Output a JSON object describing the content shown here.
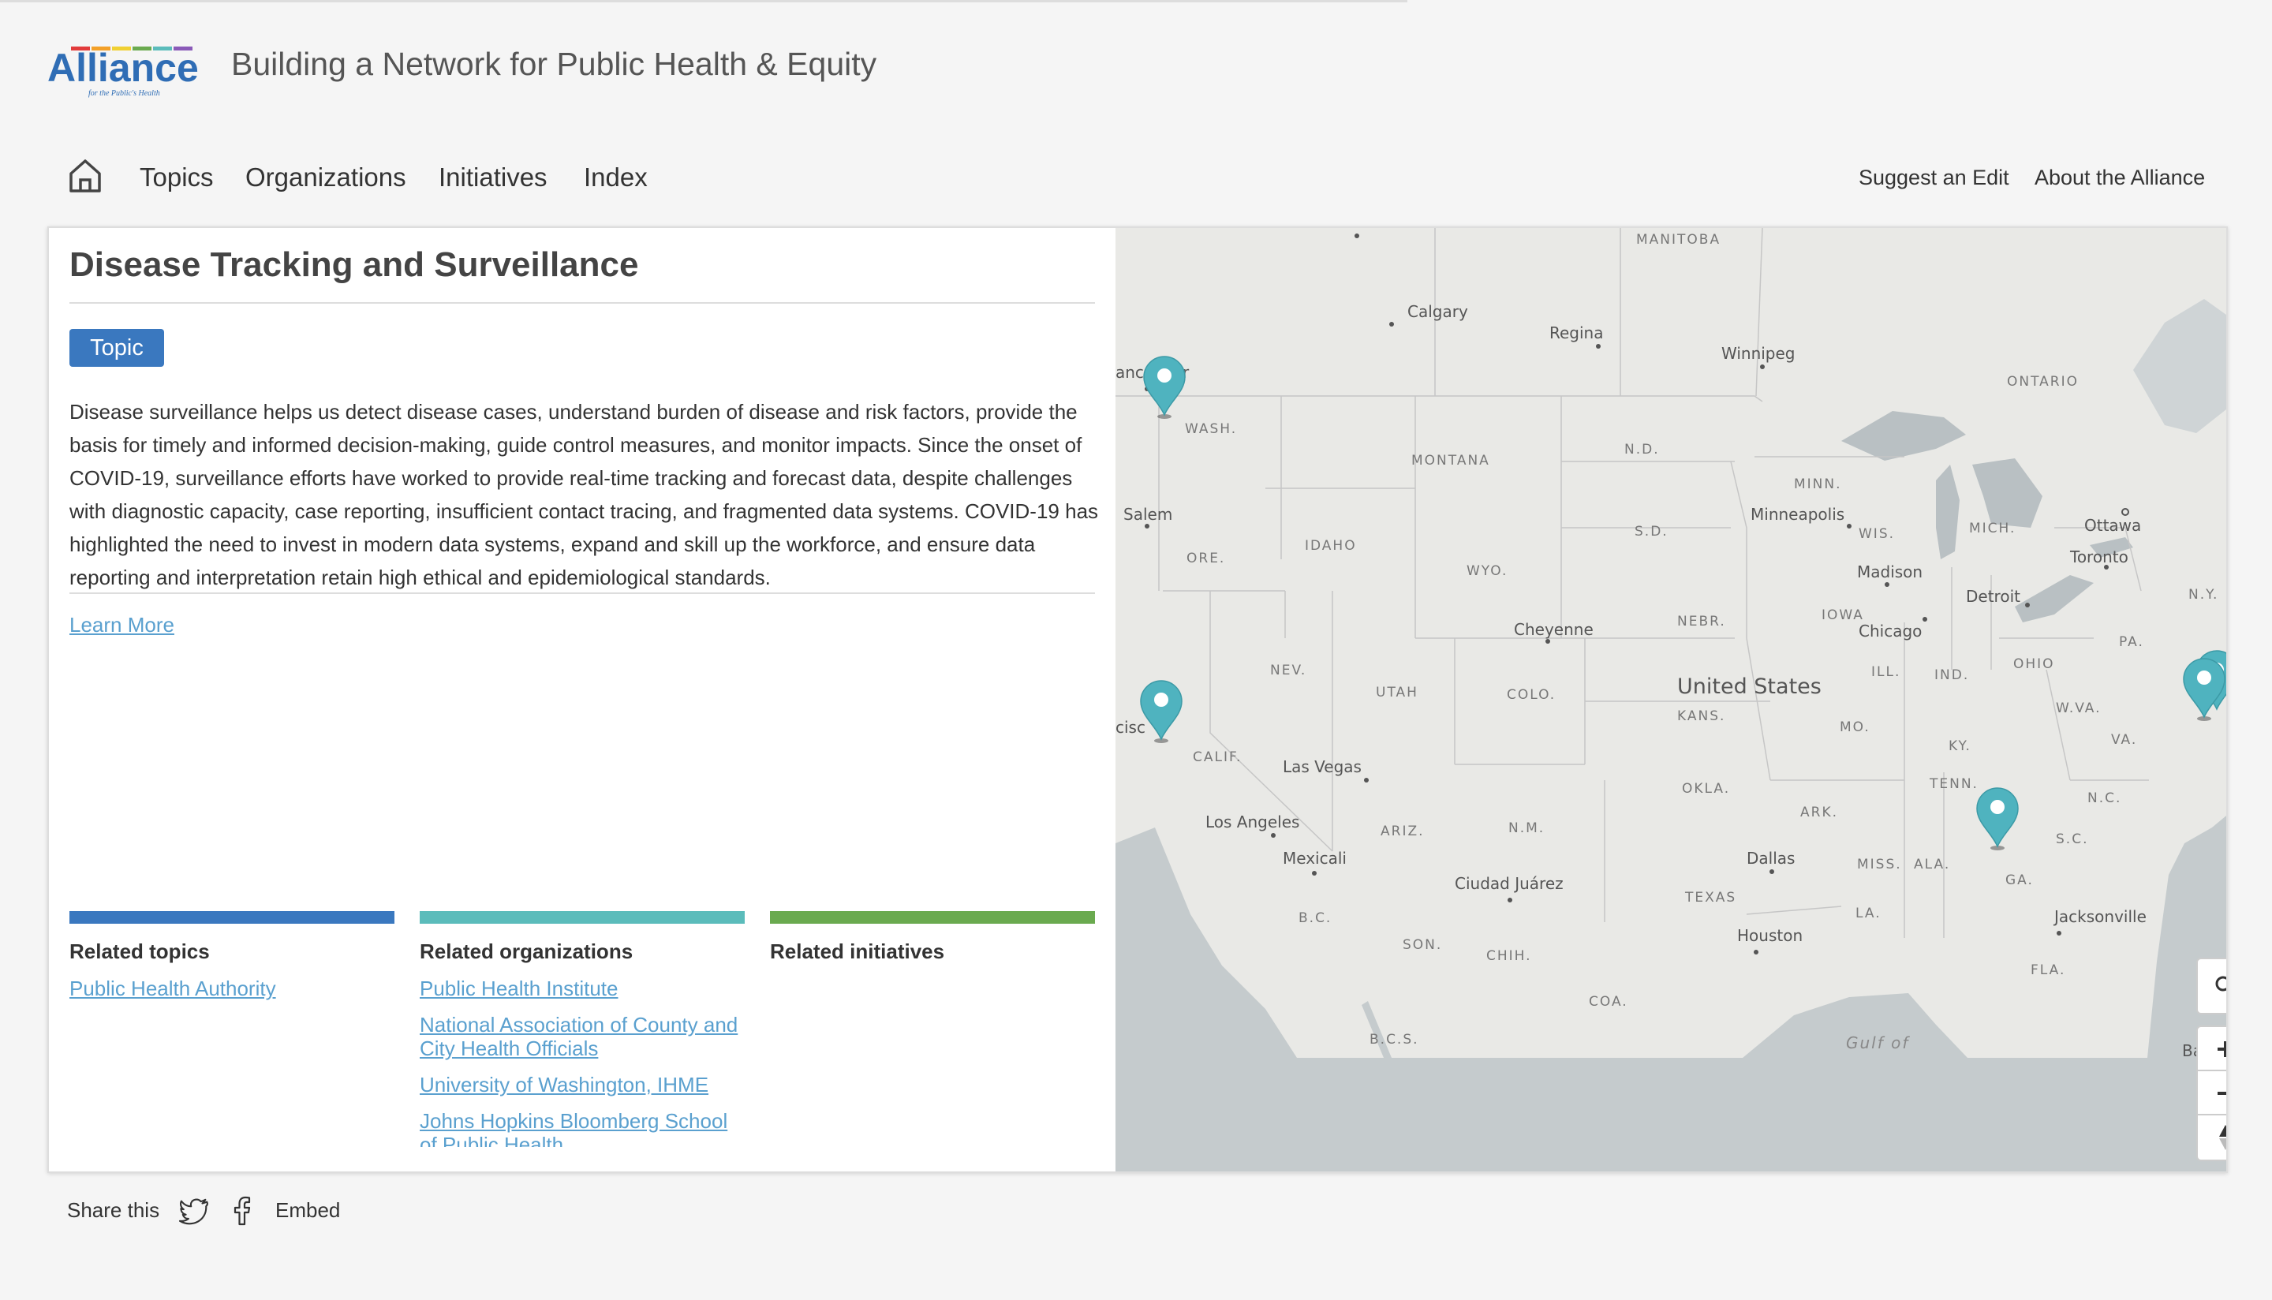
{
  "header": {
    "logo_text": "Alliance",
    "logo_tagline": "for the Public's Health",
    "site_title": "Building a Network for Public Health & Equity"
  },
  "nav": {
    "items": [
      {
        "label": "Topics"
      },
      {
        "label": "Organizations"
      },
      {
        "label": "Initiatives"
      },
      {
        "label": "Index"
      }
    ],
    "right": [
      {
        "label": "Suggest an Edit"
      },
      {
        "label": "About the Alliance"
      }
    ]
  },
  "article": {
    "title": "Disease Tracking and Surveillance",
    "badge": "Topic",
    "description": "Disease surveillance helps us detect disease cases, understand burden of disease and risk factors, provide the basis for timely and informed decision-making, guide control measures, and monitor impacts. Since the onset of COVID-19, surveillance efforts have worked to provide real-time tracking and forecast data, despite challenges with diagnostic capacity, case reporting, insufficient contact tracing, and fragmented data systems. COVID-19 has highlighted the need to invest in modern data systems, expand and skill up the workforce, and ensure data reporting and interpretation retain high ethical and epidemiological standards.",
    "learn_more": "Learn More"
  },
  "related": {
    "topics": {
      "heading": "Related topics",
      "color": "#3a78bf",
      "links": [
        "Public Health Authority"
      ]
    },
    "organizations": {
      "heading": "Related organizations",
      "color": "#5bbcbb",
      "links": [
        "Public Health Institute",
        "National Association of County and City Health Officials",
        "University of Washington, IHME",
        "Johns Hopkins Bloomberg School of Public Health"
      ]
    },
    "initiatives": {
      "heading": "Related initiatives",
      "color": "#6aaa4f",
      "links": []
    }
  },
  "map": {
    "marker_color": "#4fb3bf",
    "labels": {
      "manitoba": "MANITOBA",
      "ontario": "ONTARIO",
      "calgary": "Calgary",
      "regina": "Regina",
      "winnipeg": "Winnipeg",
      "vancouver": "ancouver",
      "wash": "WASH.",
      "montana": "MONTANA",
      "nd": "N.D.",
      "minn": "MINN.",
      "minneapolis": "Minneapolis",
      "salem": "Salem",
      "ore": "ORE.",
      "idaho": "IDAHO",
      "wyo": "WYO.",
      "sd": "S.D.",
      "wis": "WIS.",
      "mich": "MICH.",
      "ottawa": "Ottawa",
      "toronto": "Toronto",
      "madison": "Madison",
      "detroit": "Detroit",
      "ny": "N.Y.",
      "cheyenne": "Cheyenne",
      "nebr": "NEBR.",
      "iowa": "IOWA",
      "chicago": "Chicago",
      "pa": "PA.",
      "nev": "NEV.",
      "utah": "UTAH",
      "colo": "COLO.",
      "united_states": "United States",
      "kans": "KANS.",
      "ill": "ILL.",
      "ind": "IND.",
      "ohio": "OHIO",
      "wva": "W.VA.",
      "sanfrancisco": "cisc",
      "mo": "MO.",
      "ky": "KY.",
      "va": "VA.",
      "calif": "CALIF.",
      "lasvegas": "Las Vegas",
      "okla": "OKLA.",
      "tenn": "TENN.",
      "nc": "N.C.",
      "ark": "ARK.",
      "losangeles": "Los Angeles",
      "ariz": "ARIZ.",
      "nm": "N.M.",
      "sc": "S.C.",
      "mexicali": "Mexicali",
      "dallas": "Dallas",
      "miss": "MISS.",
      "ala": "ALA.",
      "ciudadjuarez": "Ciudad Juárez",
      "ga": "GA.",
      "texas": "TEXAS",
      "bc": "B.C.",
      "jacksonville": "Jacksonville",
      "la": "LA.",
      "houston": "Houston",
      "son": "SON.",
      "chih": "CHIH.",
      "fla": "FLA.",
      "coa": "COA.",
      "bcs": "B.C.S.",
      "gulf": "Gulf of",
      "bah": "Bah"
    }
  },
  "share": {
    "label": "Share this",
    "embed": "Embed"
  }
}
